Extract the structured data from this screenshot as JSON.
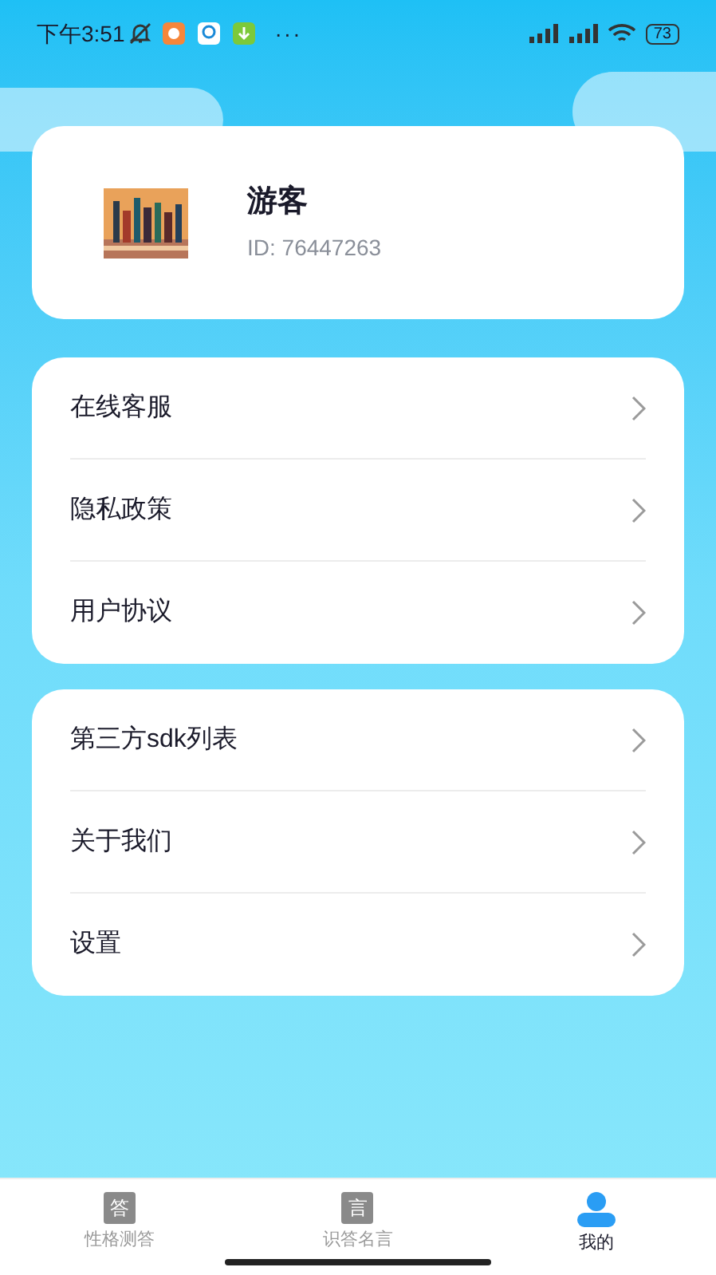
{
  "status_bar": {
    "time": "下午3:51",
    "more": "···",
    "battery": "73"
  },
  "profile": {
    "name": "游客",
    "id": "ID: 76447263"
  },
  "menu_groups": [
    {
      "items": [
        {
          "label": "在线客服"
        },
        {
          "label": "隐私政策"
        },
        {
          "label": "用户协议"
        }
      ]
    },
    {
      "items": [
        {
          "label": "第三方sdk列表"
        },
        {
          "label": "关于我们"
        },
        {
          "label": "设置"
        }
      ]
    }
  ],
  "tab_bar": [
    {
      "label": "性格测答",
      "icon_char": "答",
      "selected": false
    },
    {
      "label": "识答名言",
      "icon_char": "言",
      "selected": false
    },
    {
      "label": "我的",
      "selected": true
    }
  ]
}
